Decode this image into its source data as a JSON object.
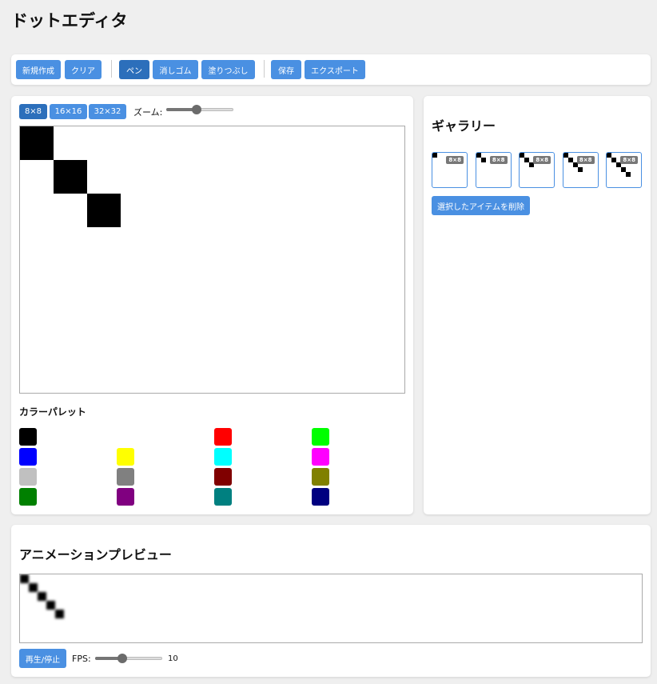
{
  "app": {
    "title": "ドットエディタ"
  },
  "toolbar": {
    "new_label": "新規作成",
    "clear_label": "クリア",
    "pen_label": "ペン",
    "eraser_label": "消しゴム",
    "fill_label": "塗りつぶし",
    "save_label": "保存",
    "export_label": "エクスポート",
    "active_tool": "pen"
  },
  "editor": {
    "sizes": [
      "8×8",
      "16×16",
      "32×32"
    ],
    "selected_size": "8×8",
    "zoom_label": "ズーム:",
    "zoom_level": 0.45,
    "grid_size": 8,
    "filled_cells": [
      [
        0,
        0
      ],
      [
        1,
        1
      ],
      [
        2,
        2
      ]
    ]
  },
  "palette": {
    "title": "カラーパレット",
    "colors": [
      "#000000",
      "#ffffff",
      "#ff0000",
      "#00ff00",
      "#0000ff",
      "#ffff00",
      "#00ffff",
      "#ff00ff",
      "#c0c0c0",
      "#808080",
      "#800000",
      "#808000",
      "#008000",
      "#800080",
      "#008080",
      "#000080"
    ]
  },
  "gallery": {
    "title": "ギャラリー",
    "items": [
      {
        "size": "8×8",
        "cells": [
          [
            0,
            0
          ]
        ]
      },
      {
        "size": "8×8",
        "cells": [
          [
            0,
            0
          ],
          [
            1,
            1
          ]
        ]
      },
      {
        "size": "8×8",
        "cells": [
          [
            0,
            0
          ],
          [
            1,
            1
          ],
          [
            2,
            2
          ]
        ]
      },
      {
        "size": "8×8",
        "cells": [
          [
            0,
            0
          ],
          [
            1,
            1
          ],
          [
            2,
            2
          ],
          [
            3,
            3
          ]
        ]
      },
      {
        "size": "8×8",
        "cells": [
          [
            0,
            0
          ],
          [
            1,
            1
          ],
          [
            2,
            2
          ],
          [
            3,
            3
          ],
          [
            4,
            4
          ]
        ]
      }
    ],
    "delete_label": "選択したアイテムを削除"
  },
  "animation": {
    "title": "アニメーションプレビュー",
    "play_label": "再生/停止",
    "fps_label": "FPS:",
    "fps_value": "10",
    "fps_level": 0.4
  },
  "colors": {
    "accent": "#4a90e2",
    "accent_active": "#2c6fbb",
    "background": "#efefef"
  }
}
